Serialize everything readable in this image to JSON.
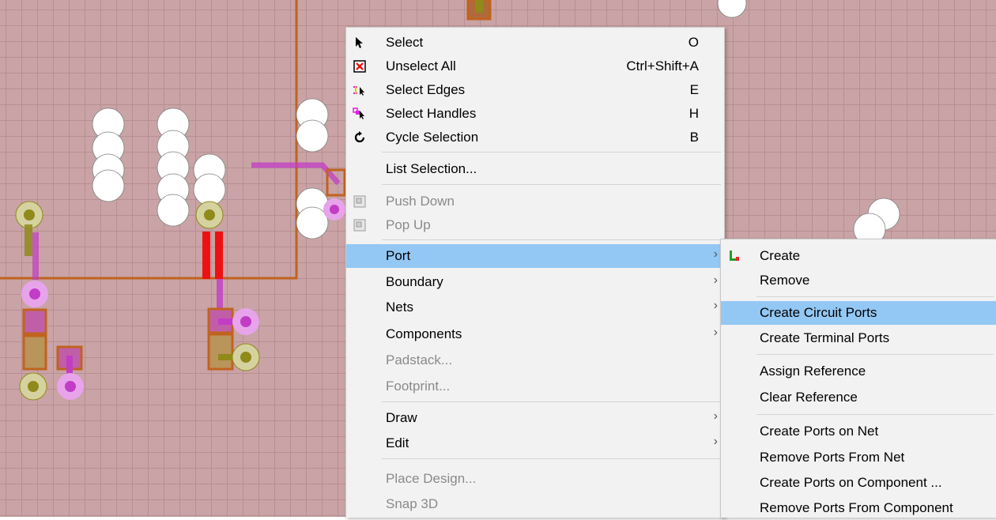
{
  "colors": {
    "canvas_bg": "#c9a3a5",
    "grid_line": "#b88f92",
    "menu_bg": "#f2f2f2",
    "menu_highlight": "#93c7f4",
    "disabled_text": "#8a8a8a",
    "trace_magenta": "#c23cc6",
    "trace_olive": "#8f8a1a",
    "boundary_orange": "#c0631f",
    "red_trace": "#ee1111"
  },
  "context_menu": {
    "items": [
      {
        "label": "Select",
        "shortcut": "O",
        "icon": "cursor-arrow-icon"
      },
      {
        "label": "Unselect All",
        "shortcut": "Ctrl+Shift+A",
        "icon": "unselect-all-icon"
      },
      {
        "label": "Select Edges",
        "shortcut": "E",
        "icon": "select-edges-icon"
      },
      {
        "label": "Select Handles",
        "shortcut": "H",
        "icon": "select-handles-icon"
      },
      {
        "label": "Cycle Selection",
        "shortcut": "B",
        "icon": "cycle-selection-icon"
      },
      {
        "label": "List Selection..."
      },
      {
        "label": "Push Down",
        "icon": "push-down-icon"
      },
      {
        "label": "Pop Up",
        "icon": "pop-up-icon"
      },
      {
        "label": "Port"
      },
      {
        "label": "Boundary"
      },
      {
        "label": "Nets"
      },
      {
        "label": "Components"
      },
      {
        "label": "Padstack..."
      },
      {
        "label": "Footprint..."
      },
      {
        "label": "Draw"
      },
      {
        "label": "Edit"
      },
      {
        "label": "Place Design..."
      },
      {
        "label": "Snap 3D"
      }
    ]
  },
  "port_submenu": {
    "items": [
      {
        "label": "Create",
        "icon": "create-port-icon"
      },
      {
        "label": "Remove"
      },
      {
        "label": "Create Circuit Ports"
      },
      {
        "label": "Create Terminal Ports"
      },
      {
        "label": "Assign Reference"
      },
      {
        "label": "Clear Reference"
      },
      {
        "label": "Create Ports on Net"
      },
      {
        "label": "Remove Ports From Net"
      },
      {
        "label": "Create Ports on Component ..."
      },
      {
        "label": "Remove Ports From Component"
      }
    ]
  },
  "submenu_arrow": "›"
}
